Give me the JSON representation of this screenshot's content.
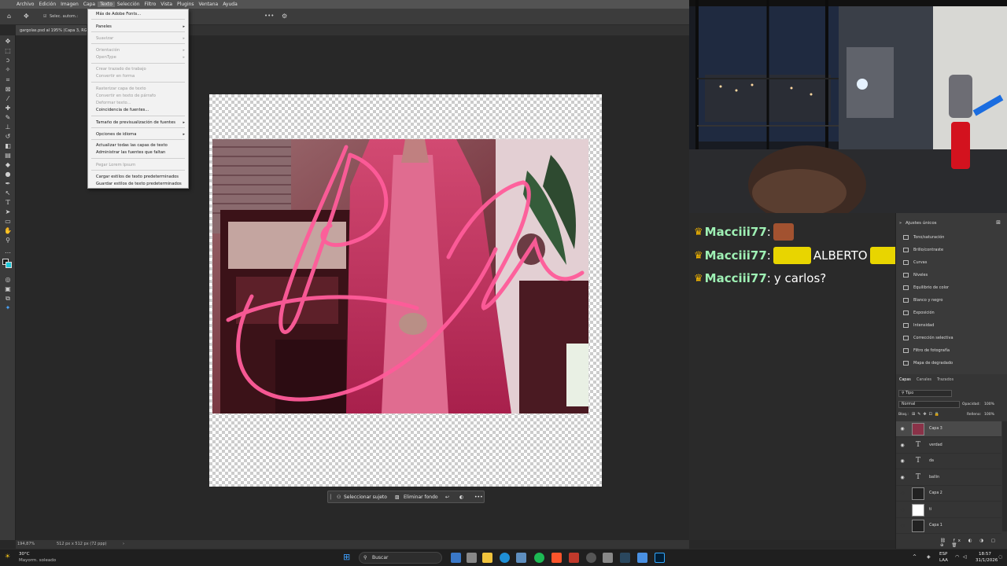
{
  "photoshop": {
    "menubar": [
      "Archivo",
      "Edición",
      "Imagen",
      "Capa",
      "Texto",
      "Selección",
      "Filtro",
      "Vista",
      "Plugins",
      "Ventana",
      "Ayuda"
    ],
    "options_bar": {
      "auto_select": "Selec. autom.:",
      "more": "•••"
    },
    "document_tab": "gargolas.psd al 195% (Capa 3, RGB/8#)",
    "status": {
      "zoom": "194,87%",
      "size": "512 px x 512 px (72 ppp)"
    },
    "context_bar": {
      "select_subject": "Seleccionar sujeto",
      "remove_bg": "Eliminar fondo",
      "more": "•••"
    },
    "texto_menu": {
      "items": [
        {
          "label": "Más de Adobe Fonts...",
          "disabled": false,
          "submenu": false
        },
        {
          "label": "Paneles",
          "disabled": false,
          "submenu": true
        },
        {
          "label": "Suavizar",
          "disabled": true,
          "submenu": true
        },
        {
          "label": "Orientación",
          "disabled": true,
          "submenu": true
        },
        {
          "label": "OpenType",
          "disabled": true,
          "submenu": true
        },
        {
          "label": "Crear trazado de trabajo",
          "disabled": true,
          "submenu": false
        },
        {
          "label": "Convertir en forma",
          "disabled": true,
          "submenu": false
        },
        {
          "label": "Rasterizar capa de texto",
          "disabled": true,
          "submenu": false
        },
        {
          "label": "Convertir en texto de párrafo",
          "disabled": true,
          "submenu": false
        },
        {
          "label": "Deformar texto...",
          "disabled": true,
          "submenu": false
        },
        {
          "label": "Coincidencia de fuentes...",
          "disabled": false,
          "submenu": false
        },
        {
          "label": "Tamaño de previsualización de fuentes",
          "disabled": false,
          "submenu": true
        },
        {
          "label": "Opciones de idioma",
          "disabled": false,
          "submenu": true
        },
        {
          "label": "Actualizar todas las capas de texto",
          "disabled": false,
          "submenu": false
        },
        {
          "label": "Administrar las fuentes que faltan",
          "disabled": false,
          "submenu": false
        },
        {
          "label": "Pegar Lorem Ipsum",
          "disabled": true,
          "submenu": false
        },
        {
          "label": "Cargar estilos de texto predeterminados",
          "disabled": false,
          "submenu": false
        },
        {
          "label": "Guardar estilos de texto predeterminados",
          "disabled": false,
          "submenu": false
        }
      ]
    }
  },
  "chat": {
    "messages": [
      {
        "user": "Macciii77",
        "text": ""
      },
      {
        "user": "Macciii77",
        "text": "ALBERTO"
      },
      {
        "user": "Macciii77",
        "text": "y carlos?"
      }
    ]
  },
  "adjustments": {
    "title": "Ajustes únicos",
    "items": [
      "Tono/saturación",
      "Brillo/contraste",
      "Curvas",
      "Niveles",
      "Equilibrio de color",
      "Blanco y negro",
      "Exposición",
      "Intensidad",
      "Corrección selectiva",
      "Filtro de fotografía",
      "Mapa de degradado"
    ]
  },
  "layers": {
    "tabs": [
      "Capas",
      "Canales",
      "Trazados"
    ],
    "filter": "Tipo",
    "blend_mode": "Normal",
    "opacity_label": "Opacidad:",
    "opacity": "100%",
    "lock_label": "Bloq.:",
    "fill_label": "Relleno:",
    "fill": "100%",
    "rows": [
      {
        "name": "Capa 3",
        "kind": "image",
        "visible": true,
        "selected": true
      },
      {
        "name": "verdad",
        "kind": "text",
        "visible": true,
        "selected": false
      },
      {
        "name": "da",
        "kind": "text",
        "visible": true,
        "selected": false
      },
      {
        "name": "ballin",
        "kind": "text",
        "visible": true,
        "selected": false
      },
      {
        "name": "Capa 2",
        "kind": "image",
        "visible": false,
        "selected": false
      },
      {
        "name": "ti",
        "kind": "image",
        "visible": false,
        "selected": false
      },
      {
        "name": "Capa 1",
        "kind": "image",
        "visible": false,
        "selected": false
      }
    ]
  },
  "taskbar": {
    "weather_temp": "30°C",
    "weather_desc": "Mayorm. soleado",
    "search": "Buscar",
    "lang": "ESP",
    "lang2": "LAA",
    "time": "18:57",
    "date": "31/1/2026"
  }
}
